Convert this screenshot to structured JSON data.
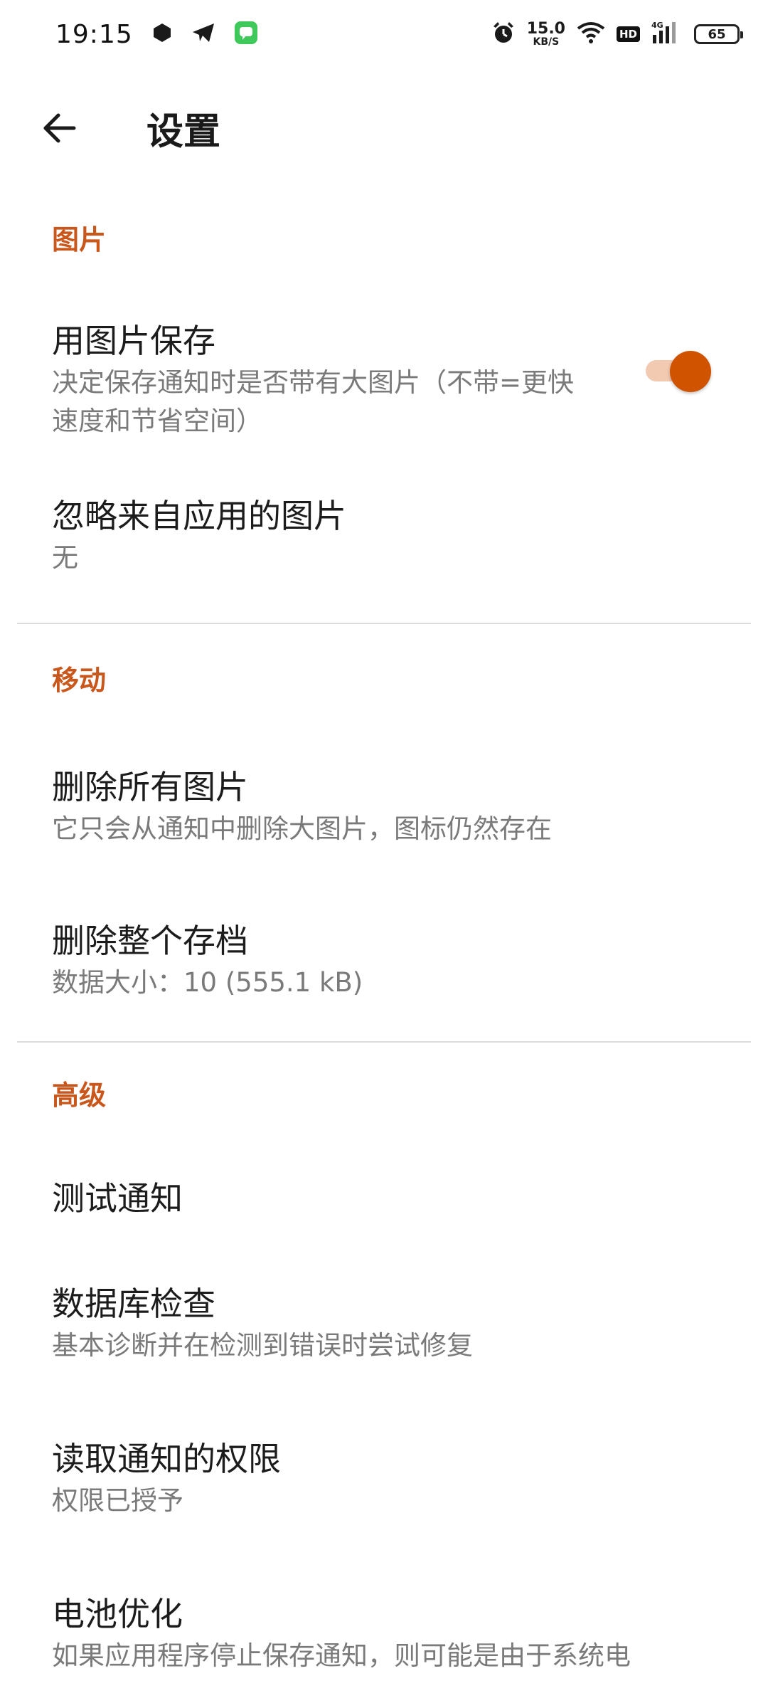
{
  "status_bar": {
    "time": "19:15",
    "net_speed_value": "15.0",
    "net_speed_unit": "KB/S",
    "hd_label": "HD",
    "signal_label": "4G",
    "battery_level": "65",
    "icons_left": [
      "hexagon-app-icon",
      "telegram-icon",
      "messages-app-icon"
    ],
    "icons_right": [
      "alarm-icon",
      "wifi-icon",
      "hd-icon",
      "signal-icon",
      "battery-icon"
    ]
  },
  "toolbar": {
    "back_icon": "arrow-left-icon",
    "title": "设置"
  },
  "sections": {
    "images": {
      "header": "图片",
      "save_with_images": {
        "title": "用图片保存",
        "summary": "决定保存通知时是否带有大图片（不带=更快速度和节省空间）",
        "enabled": true
      },
      "ignore_images": {
        "title": "忽略来自应用的图片",
        "summary": "无"
      }
    },
    "move": {
      "header": "移动",
      "delete_images": {
        "title": "删除所有图片",
        "summary": "它只会从通知中删除大图片，图标仍然存在"
      },
      "delete_archive": {
        "title": "删除整个存档",
        "summary": "数据大小：10 (555.1 kB)"
      }
    },
    "advanced": {
      "header": "高级",
      "test_notification": {
        "title": "测试通知"
      },
      "db_check": {
        "title": "数据库检查",
        "summary": "基本诊断并在检测到错误时尝试修复"
      },
      "permission": {
        "title": "读取通知的权限",
        "summary": "权限已授予"
      },
      "battery_opt": {
        "title": "电池优化",
        "summary": "如果应用程序停止保存通知，则可能是由于系统电"
      }
    }
  },
  "colors": {
    "accent": "#c9561b",
    "switch_thumb": "#d05400",
    "switch_track": "#f2c9b1"
  }
}
